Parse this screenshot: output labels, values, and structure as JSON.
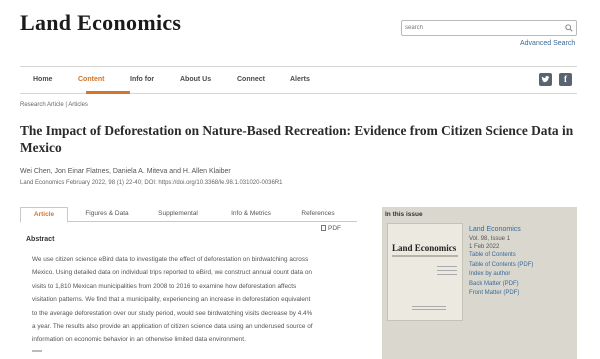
{
  "header": {
    "logo": "Land Economics",
    "search_placeholder": "search",
    "advanced_search": "Advanced Search"
  },
  "nav": {
    "items": [
      "Home",
      "Content",
      "Info for",
      "About Us",
      "Connect",
      "Alerts"
    ],
    "active": "Content",
    "social_icons": [
      "twitter-icon",
      "facebook-icon"
    ]
  },
  "breadcrumb": "Research Article | Articles",
  "article": {
    "title": "The Impact of Deforestation on Nature-Based Recreation: Evidence from Citizen Science Data in Mexico",
    "authors": "Wei Chen, Jon Einar Flatnes, Daniela A. Miteva and H. Allen Klaiber",
    "citation": "Land Economics February 2022, 98 (1) 22-40; DOI: https://doi.org/10.3368/le.98.1.031020-0036R1"
  },
  "tabs": {
    "items": [
      "Article",
      "Figures & Data",
      "Supplemental",
      "Info & Metrics",
      "References"
    ],
    "active": "Article"
  },
  "pdf_label": "PDF",
  "abstract": {
    "heading": "Abstract",
    "lines": [
      "We use citizen science eBird data to investigate the effect of deforestation on birdwatching across",
      "Mexico. Using detailed data on individual trips reported to eBird, we construct annual count data on",
      "visits to 1,810 Mexican municipalities from 2008 to 2016 to examine how deforestation affects",
      "visitation patterns. We find that a municipality, experiencing an increase in deforestation equivalent",
      "to the average deforestation over our study period, would see birdwatching visits decrease by 4.4%",
      "a year. The results also provide an application of citizen science data using an underused source of",
      "information on economic behavior in an otherwise limited data environment."
    ]
  },
  "issue": {
    "heading": "In this issue",
    "cover_title": "Land Economics",
    "journal": "Land Economics",
    "volume": "Vol. 98, Issue 1",
    "date": "1 Feb 2022",
    "links": [
      "Table of Contents",
      "Table of Contents (PDF)",
      "Index by author",
      "Back Matter (PDF)",
      "Front Matter (PDF)"
    ]
  },
  "colors": {
    "accent": "#d1762c",
    "link": "#3a6a9a",
    "sidebar_bg": "#d9d7ce"
  }
}
